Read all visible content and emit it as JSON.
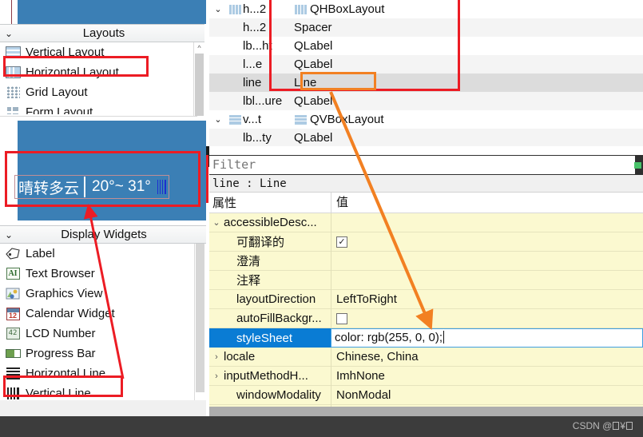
{
  "left_panel": {
    "layouts_section": {
      "title": "Layouts",
      "chevron": "⌄",
      "items": [
        {
          "label": "Vertical Layout",
          "icon": "vertical-layout-icon"
        },
        {
          "label": "Horizontal Layout",
          "icon": "horizontal-layout-icon"
        },
        {
          "label": "Grid Layout",
          "icon": "grid-layout-icon"
        },
        {
          "label": "Form Layout",
          "icon": "form-layout-icon"
        }
      ]
    },
    "display_section": {
      "title": "Display Widgets",
      "chevron": "⌄",
      "items": [
        {
          "label": "Label",
          "icon": "label-icon"
        },
        {
          "label": "Text Browser",
          "icon": "text-browser-icon"
        },
        {
          "label": "Graphics View",
          "icon": "graphics-view-icon"
        },
        {
          "label": "Calendar Widget",
          "icon": "calendar-icon"
        },
        {
          "label": "LCD Number",
          "icon": "lcd-number-icon"
        },
        {
          "label": "Progress Bar",
          "icon": "progress-bar-icon"
        },
        {
          "label": "Horizontal Line",
          "icon": "horizontal-line-icon"
        },
        {
          "label": "Vertical Line",
          "icon": "vertical-line-icon"
        }
      ]
    }
  },
  "preview": {
    "condition": "晴转多云",
    "temperature": "20°~ 31°",
    "separator": "|",
    "line_widget": "vertical-line-widget"
  },
  "object_tree": {
    "rows": [
      {
        "expander": "⌄",
        "icon": "hbox-layout-icon",
        "name": "h...2",
        "class_icon": "hbox-layout-icon",
        "class": "QHBoxLayout",
        "indent": 0,
        "selected": false
      },
      {
        "expander": "",
        "icon": "",
        "name": "h...2",
        "class": "Spacer",
        "indent": 1,
        "selected": false
      },
      {
        "expander": "",
        "icon": "",
        "name": "lb...ht",
        "class": "QLabel",
        "indent": 1,
        "selected": false
      },
      {
        "expander": "",
        "icon": "",
        "name": "l...e",
        "class": "QLabel",
        "indent": 1,
        "selected": false
      },
      {
        "expander": "",
        "icon": "",
        "name": "line",
        "class": "Line",
        "indent": 1,
        "selected": true
      },
      {
        "expander": "",
        "icon": "",
        "name": "lbl...ure",
        "class": "QLabel",
        "indent": 0,
        "selected": false
      },
      {
        "expander": "⌄",
        "icon": "vbox-layout-icon",
        "name": "v...t",
        "class_icon": "vbox-layout-icon",
        "class": "QVBoxLayout",
        "indent": 0,
        "selected": false
      },
      {
        "expander": "",
        "icon": "",
        "name": "lb...ty",
        "class": "QLabel",
        "indent": 1,
        "selected": false
      }
    ]
  },
  "property_editor": {
    "filter_placeholder": "Filter",
    "filter_value": "",
    "object_header": "line : Line",
    "columns": {
      "name": "属性",
      "value": "值"
    },
    "rows": [
      {
        "name": "accessibleDesc...",
        "value": "",
        "arrow": "⌄",
        "indent": false,
        "selected": false,
        "kind": "text"
      },
      {
        "name": "可翻译的",
        "value": "✓",
        "arrow": "",
        "indent": true,
        "selected": false,
        "kind": "checkbox",
        "checked": true
      },
      {
        "name": "澄清",
        "value": "",
        "arrow": "",
        "indent": true,
        "selected": false,
        "kind": "text"
      },
      {
        "name": "注释",
        "value": "",
        "arrow": "",
        "indent": true,
        "selected": false,
        "kind": "text"
      },
      {
        "name": "layoutDirection",
        "value": "LeftToRight",
        "arrow": "",
        "indent": true,
        "selected": false,
        "kind": "text"
      },
      {
        "name": "autoFillBackgr...",
        "value": "",
        "arrow": "",
        "indent": true,
        "selected": false,
        "kind": "checkbox",
        "checked": false
      },
      {
        "name": "styleSheet",
        "value": "color: rgb(255, 0, 0);",
        "arrow": "",
        "indent": true,
        "selected": true,
        "kind": "editing"
      },
      {
        "name": "locale",
        "value": "Chinese, China",
        "arrow": "›",
        "indent": false,
        "selected": false,
        "kind": "text"
      },
      {
        "name": "inputMethodH...",
        "value": "ImhNone",
        "arrow": "›",
        "indent": false,
        "selected": false,
        "kind": "text"
      },
      {
        "name": "windowModality",
        "value": "NonModal",
        "arrow": "",
        "indent": true,
        "selected": false,
        "kind": "text"
      }
    ]
  },
  "annotations": {
    "red_color": "#ec1c24",
    "orange_color": "#f28022",
    "boxes": [
      {
        "target": "horizontal-layout-item"
      },
      {
        "target": "weather-preview-widget"
      },
      {
        "target": "vertical-line-item"
      },
      {
        "target": "hbox-layout-subtree"
      },
      {
        "target": "line-tree-row"
      }
    ],
    "arrows": [
      {
        "from": "line-tree-row",
        "to": "stylesheet-value-cell",
        "color": "#f28022"
      },
      {
        "from": "vertical-line-item",
        "to": "weather-preview-separator",
        "color": "#ec1c24"
      }
    ]
  },
  "watermark": {
    "prefix": "CSDN @",
    "suffix_unrenderable": "□¥□"
  }
}
